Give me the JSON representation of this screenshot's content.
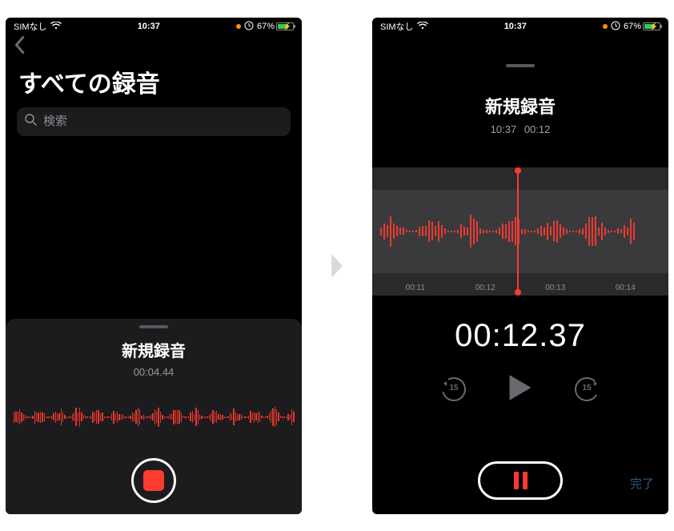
{
  "status": {
    "carrier": "SIMなし",
    "time": "10:37",
    "battery_pct": "67%"
  },
  "left": {
    "title": "すべての録音",
    "search_placeholder": "検索",
    "drawer": {
      "title": "新規録音",
      "elapsed": "00:04.44"
    }
  },
  "right": {
    "title": "新規録音",
    "clock_time": "10:37",
    "duration": "00:12",
    "ruler": [
      "00:11",
      "00:12",
      "00:13",
      "00:14"
    ],
    "big_timer": "00:12.37",
    "skip_amount": "15",
    "done_label": "完了"
  }
}
